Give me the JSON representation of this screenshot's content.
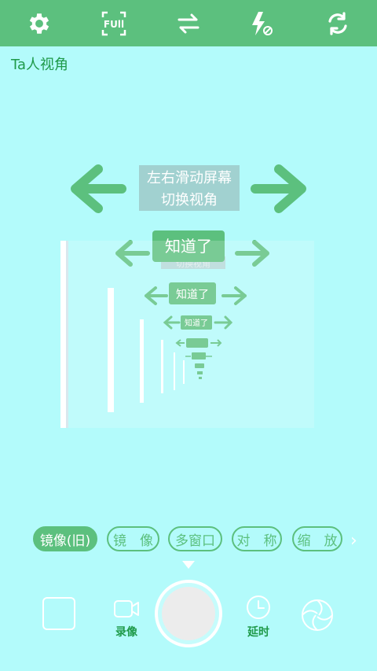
{
  "topbar": {
    "icons": [
      "settings-icon",
      "full-screen-icon",
      "swap-icon",
      "flash-off-icon",
      "switch-camera-icon"
    ],
    "full_label": "FUll"
  },
  "perspective_label": "Ta人视角",
  "guide": {
    "text_line1": "左右滑动屏幕",
    "text_line2": "切换视角",
    "got_it": "知道了",
    "hidden_text": "切换视角"
  },
  "modes": [
    {
      "label": "镜像(旧)",
      "active": true
    },
    {
      "label": "镜　像",
      "active": false
    },
    {
      "label": "多窗口",
      "active": false
    },
    {
      "label": "对　称",
      "active": false
    },
    {
      "label": "缩　放",
      "active": false
    }
  ],
  "bottom": {
    "record_label": "录像",
    "delay_label": "延时"
  },
  "colors": {
    "accent": "#5cc07e",
    "background": "#b3fbfb",
    "label_green": "#1f9a4a"
  }
}
